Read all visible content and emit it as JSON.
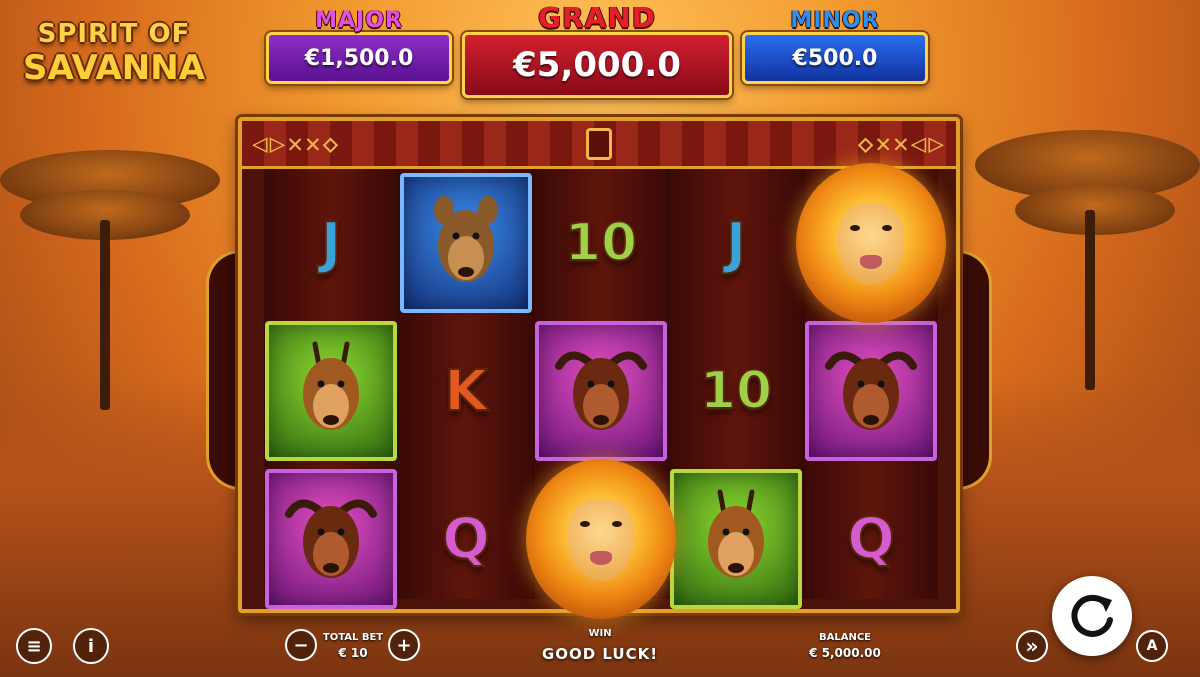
{
  "logo": {
    "line1": "SPIRIT OF",
    "line2": "SAVANNA"
  },
  "jackpots": {
    "major": {
      "label": "MAJOR",
      "value": "€1,500.0"
    },
    "grand": {
      "label": "GRAND",
      "value": "€5,000.0"
    },
    "minor": {
      "label": "MINOR",
      "value": "€500.0"
    }
  },
  "reels": [
    [
      "J",
      "gazelle",
      "buffalo"
    ],
    [
      "hyena",
      "K",
      "Q"
    ],
    [
      "10",
      "buffalo",
      "lion"
    ],
    [
      "J",
      "10",
      "gazelle"
    ],
    [
      "lion",
      "buffalo",
      "Q"
    ]
  ],
  "hud": {
    "total_bet_label": "TOTAL BET",
    "total_bet_value": "€ 10",
    "win_label": "WIN",
    "win_message": "GOOD LUCK!",
    "balance_label": "BALANCE",
    "balance_value": "€ 5,000.00",
    "minus": "−",
    "plus": "+",
    "info": "i",
    "menu": "≡",
    "turbo": "»",
    "auto": "A"
  }
}
